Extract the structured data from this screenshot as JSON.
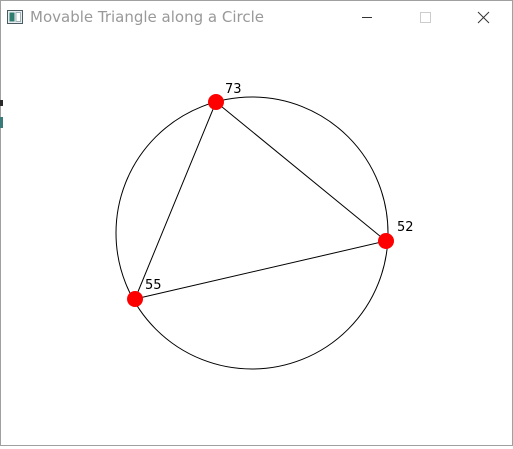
{
  "window": {
    "title": "Movable Triangle along a Circle"
  },
  "canvas": {
    "point_a_label": "73",
    "point_b_label": "52",
    "point_c_label": "55",
    "point_color": "#ff0000",
    "line_color": "#000000"
  }
}
